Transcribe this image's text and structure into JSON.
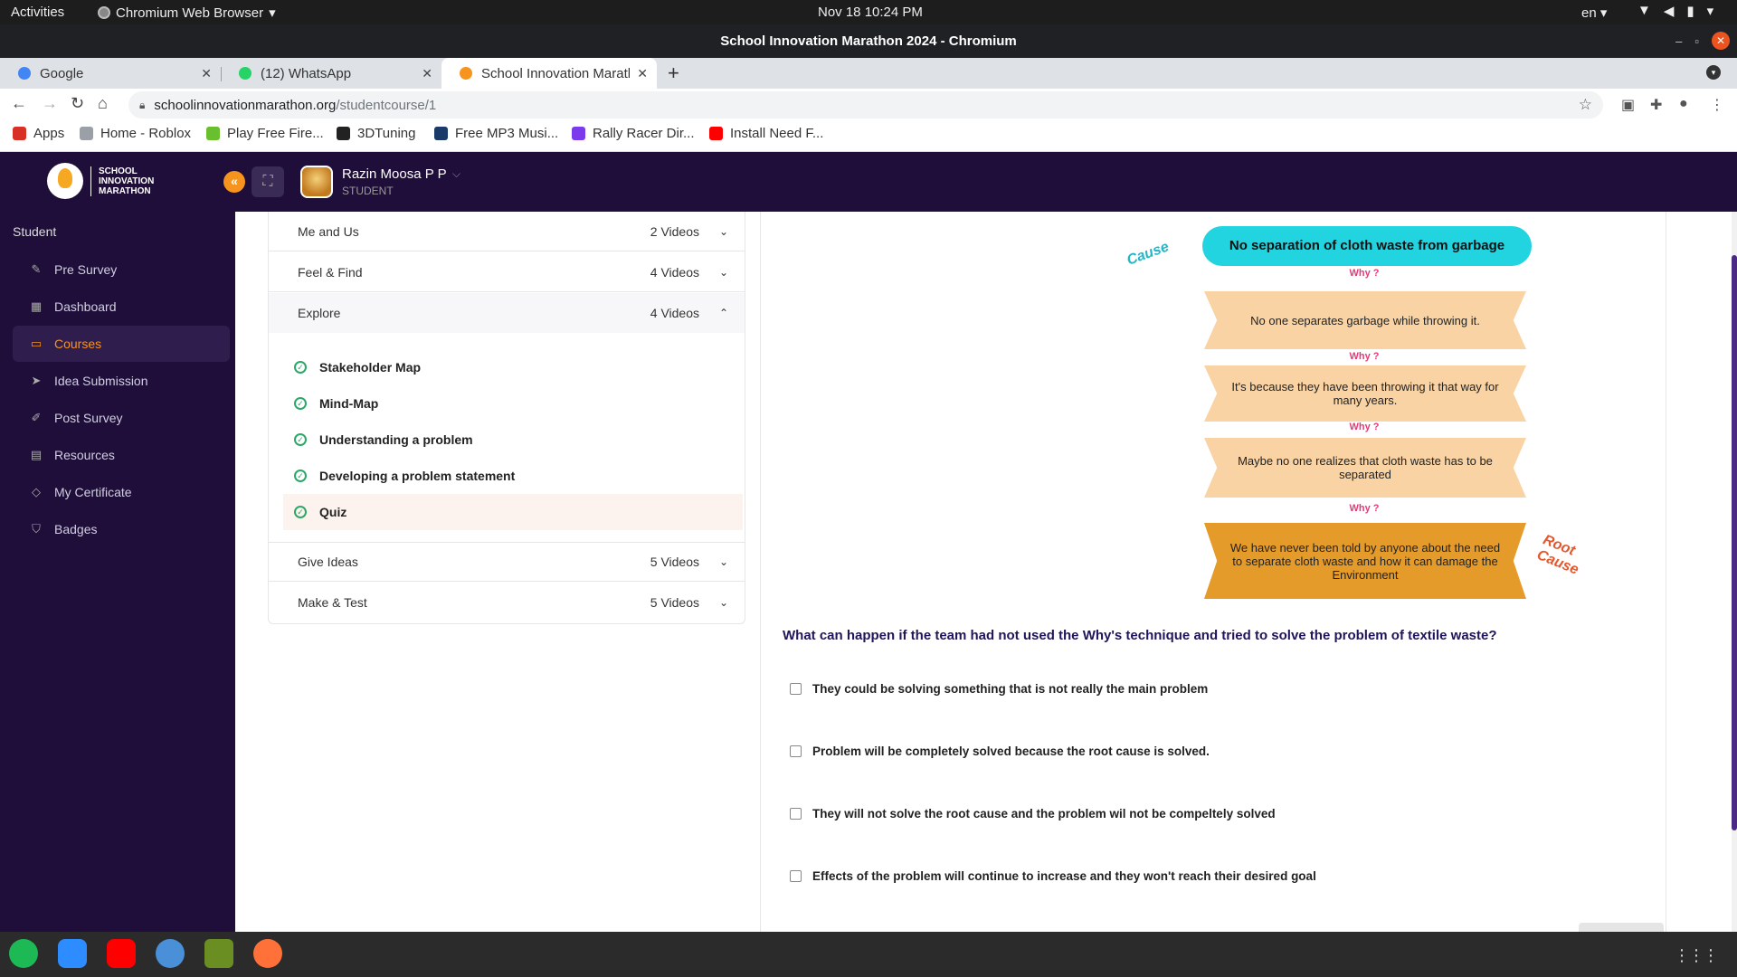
{
  "os_bar": {
    "activities": "Activities",
    "app_name": "Chromium Web Browser",
    "clock": "Nov 18  10:24 PM",
    "lang": "en"
  },
  "window": {
    "title": "School Innovation Marathon 2024 - Chromium"
  },
  "tabs": [
    {
      "label": "Google",
      "icon_color": "#4285f4"
    },
    {
      "label": "(12) WhatsApp",
      "icon_color": "#25d366"
    },
    {
      "label": "School Innovation Marath",
      "icon_color": "#f7941d"
    }
  ],
  "omnibox": {
    "host": "schoolinnovationmarathon.org",
    "path": "/studentcourse/1"
  },
  "bookmarks": [
    {
      "label": "Apps",
      "icon": "apps-grid-icon",
      "color": "#d93025"
    },
    {
      "label": "Home - Roblox",
      "icon": "roblox-icon",
      "color": "#9aa0a6"
    },
    {
      "label": "Play Free Fire...",
      "icon": "freefire-icon",
      "color": "#6abf2e"
    },
    {
      "label": "3DTuning",
      "icon": "3dtuning-icon",
      "color": "#222222"
    },
    {
      "label": "Free MP3 Musi...",
      "icon": "mp3-icon",
      "color": "#1a3a6a"
    },
    {
      "label": "Rally Racer Dir...",
      "icon": "shield-icon",
      "color": "#7c3aed"
    },
    {
      "label": "Install Need F...",
      "icon": "youtube-icon",
      "color": "#ff0000"
    }
  ],
  "site": {
    "logo_lines": [
      "SCHOOL",
      "INNOVATION",
      "MARATHON"
    ],
    "user_name": "Razin Moosa P P",
    "user_role": "STUDENT",
    "accent": "#f7941d",
    "nav_bg": "#1f0e3a"
  },
  "nav": {
    "heading": "Student",
    "items": [
      {
        "label": "Pre Survey",
        "icon": "edit-icon"
      },
      {
        "label": "Dashboard",
        "icon": "grid-icon"
      },
      {
        "label": "Courses",
        "icon": "monitor-icon",
        "active": true
      },
      {
        "label": "Idea Submission",
        "icon": "send-icon"
      },
      {
        "label": "Post Survey",
        "icon": "pen-icon"
      },
      {
        "label": "Resources",
        "icon": "file-icon"
      },
      {
        "label": "My Certificate",
        "icon": "tag-icon"
      },
      {
        "label": "Badges",
        "icon": "shield-icon"
      }
    ]
  },
  "modules": [
    {
      "title": "Me and Us",
      "count": "2 Videos",
      "expanded": false
    },
    {
      "title": "Feel & Find",
      "count": "4 Videos",
      "expanded": false
    },
    {
      "title": "Explore",
      "count": "4 Videos",
      "expanded": true
    },
    {
      "title": "Give Ideas",
      "count": "5 Videos",
      "expanded": false
    },
    {
      "title": "Make & Test",
      "count": "5 Videos",
      "expanded": false
    }
  ],
  "lessons": [
    {
      "label": "Stakeholder Map"
    },
    {
      "label": "Mind-Map"
    },
    {
      "label": "Understanding a problem"
    },
    {
      "label": "Developing a problem statement"
    },
    {
      "label": "Quiz",
      "current": true
    }
  ],
  "diagram": {
    "cause_tag": "Cause",
    "root_tag": "Root Cause",
    "head": "No separation of cloth waste from garbage",
    "why_label": "Why ?",
    "steps": [
      "No one separates garbage while throwing it.",
      "It's because they have been throwing it that way for many years.",
      "Maybe no one realizes that cloth waste has to be separated",
      "We have never been told  by anyone about the need to separate cloth waste and how it can damage the Environment"
    ]
  },
  "quiz": {
    "question": "What can happen if the team had not used the Why's technique and tried to solve the problem of textile waste?",
    "options": [
      "They could be solving something that is not really the main problem",
      "Problem will be completely solved because the root cause is solved.",
      "They will not solve the root cause and the problem wil not be compeltely solved",
      "Effects of the problem will continue to increase and they won't reach their desired goal"
    ]
  },
  "dock": [
    {
      "name": "spotify-icon",
      "color": "#1db954"
    },
    {
      "name": "zoom-icon",
      "color": "#2d8cff"
    },
    {
      "name": "youtube-icon",
      "color": "#ff0000"
    },
    {
      "name": "chromium-icon",
      "color": "#4a90d9"
    },
    {
      "name": "game-icon",
      "color": "#6b8e23"
    },
    {
      "name": "firefox-icon",
      "color": "#ff7139"
    }
  ]
}
